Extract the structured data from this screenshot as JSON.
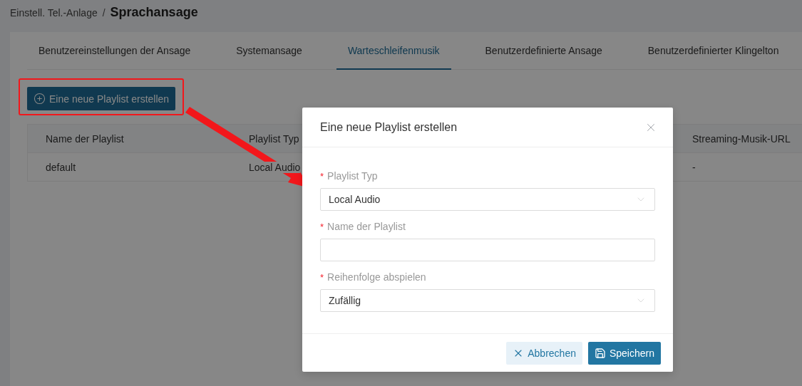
{
  "breadcrumb": {
    "parent": "Einstell. Tel.-Anlage",
    "separator": "/",
    "current": "Sprachansage"
  },
  "tabs": [
    {
      "label": "Benutzereinstellungen der Ansage",
      "selected": false
    },
    {
      "label": "Systemansage",
      "selected": false
    },
    {
      "label": "Warteschleifenmusik",
      "selected": true
    },
    {
      "label": "Benutzerdefinierte Ansage",
      "selected": false
    },
    {
      "label": "Benutzerdefinierter Klingelton",
      "selected": false
    }
  ],
  "create_button": {
    "label": "Eine neue Playlist erstellen",
    "highlighted": true
  },
  "table": {
    "columns": [
      "Name der Playlist",
      "Playlist Typ",
      "Streaming-Musik-URL"
    ],
    "rows": [
      [
        "default",
        "Local Audio",
        "-"
      ]
    ]
  },
  "dialog": {
    "title": "Eine neue Playlist erstellen",
    "fields": [
      {
        "kind": "select",
        "required_mark": "*",
        "label": "Playlist Typ",
        "value": "Local Audio"
      },
      {
        "kind": "text",
        "required_mark": "*",
        "label": "Name der Playlist"
      },
      {
        "kind": "select",
        "required_mark": "*",
        "label": "Reihenfolge abspielen",
        "value": "Zufällig"
      }
    ],
    "buttons": [
      {
        "kind": "cancel",
        "label": "Abbrechen"
      },
      {
        "kind": "save",
        "label": "Speichern"
      }
    ]
  }
}
